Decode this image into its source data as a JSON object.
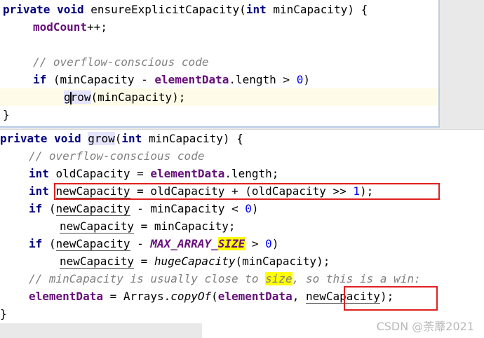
{
  "top": {
    "l1": {
      "kw1": "private",
      "kw2": "void",
      "name": " ensureExplicitCapacity",
      "p1": "(",
      "kw3": "int",
      "param": " minCapacity) {"
    },
    "l2": {
      "field": "modCount",
      "rest": "++;"
    },
    "l3": {
      "comment": "// overflow-conscious code"
    },
    "l4": {
      "kw": "if",
      "a": " (minCapacity - ",
      "field": "elementData",
      "b": ".length > ",
      "num": "0",
      "c": ")"
    },
    "l5": {
      "g": "g",
      "row": "row",
      "rest": "(minCapacity);"
    },
    "l6": {
      "brace": "}"
    }
  },
  "bottom": {
    "l1": {
      "kw1": "private",
      "kw2": "void",
      "name": "grow",
      "p1": "(",
      "kw3": "int",
      "param": " minCapacity) {"
    },
    "l2": {
      "comment": "// overflow-conscious code"
    },
    "l3": {
      "kw": "int",
      "a": " oldCapacity = ",
      "field": "elementData",
      "b": ".length;"
    },
    "l4": {
      "kw": "int",
      "var": "newCapacity",
      "a": " = oldCapacity + (oldCapacity >> ",
      "num": "1",
      "b": ");"
    },
    "l5": {
      "kw": "if",
      "a": " (",
      "var": "newCapacity",
      "b": " - minCapacity < ",
      "num": "0",
      "c": ")"
    },
    "l6": {
      "var": "newCapacity",
      "a": " = minCapacity;"
    },
    "l7": {
      "kw": "if",
      "a": " (",
      "var": "newCapacity",
      "b": " - ",
      "const1": "MAX_ARRAY_",
      "const2": "SIZE",
      "c": " > ",
      "num": "0",
      "d": ")"
    },
    "l8": {
      "var": "newCapacity",
      "a": " = ",
      "call": "hugeCapacity",
      "b": "(minCapacity);"
    },
    "l9": {
      "c1": "// minCapacity is usually close to ",
      "c2": "size",
      "c3": ", so this is a win:"
    },
    "l10": {
      "field": "elementData",
      "a": " = Arrays.",
      "call": "copyOf",
      "b": "(",
      "field2": "elementData",
      "c": ", ",
      "var": "newCapacity",
      "d": ");"
    },
    "l11": {
      "brace": "}"
    }
  },
  "watermark": "CSDN @荼蘼2021",
  "colors": {
    "keyword": "#000080",
    "field": "#660e7a",
    "number": "#0000ff",
    "comment": "#808080",
    "highlight": "#ffff00",
    "box": "#e02020"
  }
}
